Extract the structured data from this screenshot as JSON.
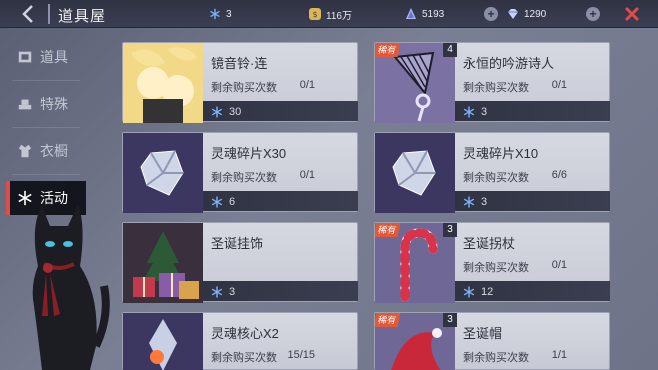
{
  "header": {
    "title": "道具屋",
    "resources": [
      {
        "name": "snowflake-token",
        "value": "3"
      },
      {
        "name": "gold-coin",
        "value": "116万"
      },
      {
        "name": "crystal",
        "value": "5193"
      },
      {
        "name": "diamond",
        "value": "1290"
      }
    ]
  },
  "sidebar": {
    "items": [
      {
        "label": "道具",
        "icon": "item-icon"
      },
      {
        "label": "特殊",
        "icon": "special-icon"
      },
      {
        "label": "衣橱",
        "icon": "wardrobe-icon"
      },
      {
        "label": "活动",
        "icon": "snowflake-icon"
      }
    ],
    "active": "活动"
  },
  "items": [
    {
      "name": "镜音铃·连",
      "label": "剩余购买次数",
      "remaining": "0/1",
      "price": "30"
    },
    {
      "name": "永恒的吟游诗人",
      "label": "剩余购买次数",
      "remaining": "0/1",
      "price": "3",
      "rare": "稀有",
      "count": "4"
    },
    {
      "name": "灵魂碎片X30",
      "label": "剩余购买次数",
      "remaining": "0/1",
      "price": "6"
    },
    {
      "name": "灵魂碎片X10",
      "label": "剩余购买次数",
      "remaining": "6/6",
      "price": "3"
    },
    {
      "name": "圣诞挂饰",
      "label": "",
      "remaining": "",
      "price": "3"
    },
    {
      "name": "圣诞拐杖",
      "label": "剩余购买次数",
      "remaining": "0/1",
      "price": "12",
      "rare": "稀有",
      "count": "3"
    },
    {
      "name": "灵魂核心X2",
      "label": "剩余购买次数",
      "remaining": "15/15",
      "price": ""
    },
    {
      "name": "圣诞帽",
      "label": "剩余购买次数",
      "remaining": "1/1",
      "price": "",
      "rare": "稀有",
      "count": "3"
    }
  ],
  "colors": {
    "accent": "#e24b4b",
    "rare": "#e05a3a",
    "snowflake": "#7fb3ff"
  }
}
